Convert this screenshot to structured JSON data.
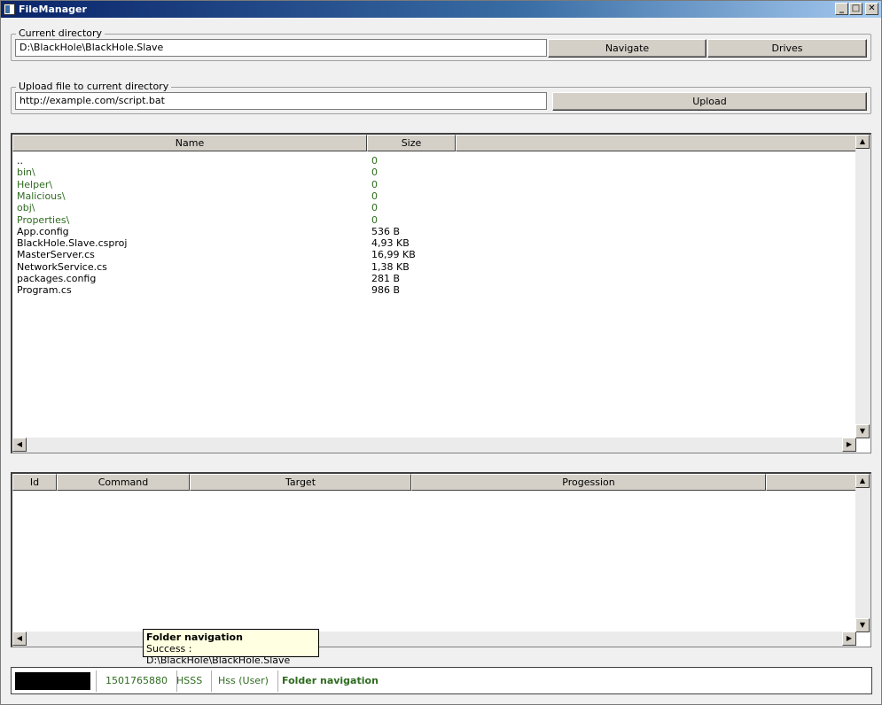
{
  "window": {
    "title": "FileManager",
    "controls": {
      "minimize": "_",
      "maximize": "□",
      "close": "✕"
    }
  },
  "current_directory": {
    "label": "Current directory",
    "value": "D:\\BlackHole\\BlackHole.Slave",
    "navigate_label": "Navigate",
    "drives_label": "Drives"
  },
  "upload": {
    "label": "Upload file to current directory",
    "value": "http://example.com/script.bat",
    "upload_label": "Upload"
  },
  "file_list": {
    "columns": [
      "Name",
      "Size"
    ],
    "rows": [
      {
        "name": "..",
        "size": "0",
        "folder": false
      },
      {
        "name": "bin\\",
        "size": "0",
        "folder": true
      },
      {
        "name": "Helper\\",
        "size": "0",
        "folder": true
      },
      {
        "name": "Malicious\\",
        "size": "0",
        "folder": true
      },
      {
        "name": "obj\\",
        "size": "0",
        "folder": true
      },
      {
        "name": "Properties\\",
        "size": "0",
        "folder": true
      },
      {
        "name": "App.config",
        "size": "536 B",
        "folder": false
      },
      {
        "name": "BlackHole.Slave.csproj",
        "size": "4,93 KB",
        "folder": false
      },
      {
        "name": "MasterServer.cs",
        "size": "16,99 KB",
        "folder": false
      },
      {
        "name": "NetworkService.cs",
        "size": "1,38 KB",
        "folder": false
      },
      {
        "name": "packages.config",
        "size": "281 B",
        "folder": false
      },
      {
        "name": "Program.cs",
        "size": "986 B",
        "folder": false
      }
    ]
  },
  "transfer_list": {
    "columns": [
      "Id",
      "Command",
      "Target",
      "Progession",
      ""
    ]
  },
  "tooltip": {
    "title": "Folder navigation",
    "text": "Success : D:\\BlackHole\\BlackHole.Slave"
  },
  "statusbar": {
    "id": "1501765880",
    "name": "HSSS",
    "user": "Hss (User)",
    "message": "Folder navigation"
  },
  "scroll_icons": {
    "up": "▲",
    "down": "▼",
    "left": "◀",
    "right": "▶"
  }
}
